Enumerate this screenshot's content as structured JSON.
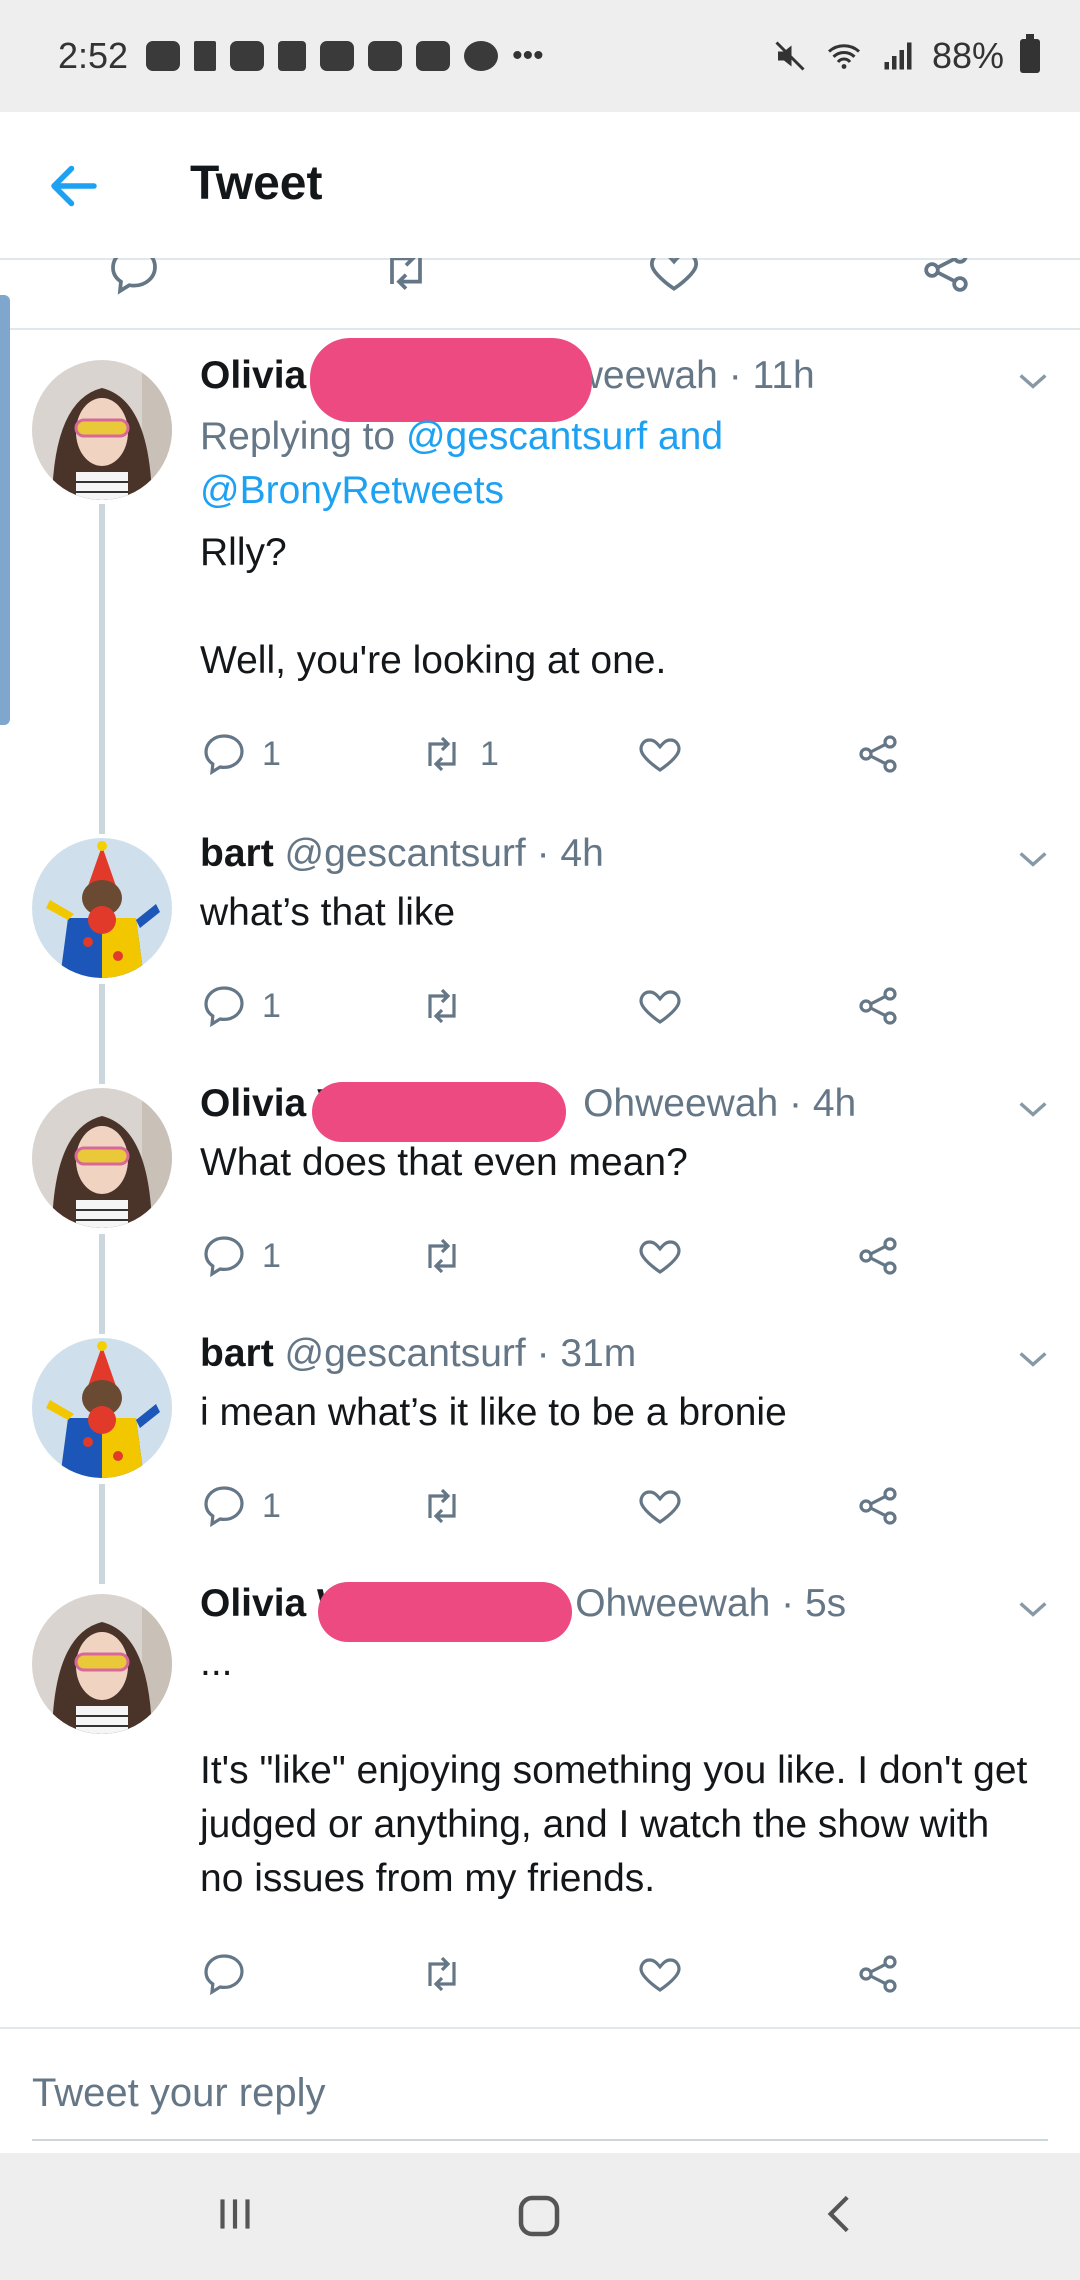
{
  "status_bar": {
    "time": "2:52",
    "battery": "88%"
  },
  "app_bar": {
    "title": "Tweet"
  },
  "tweets": [
    {
      "name": "Olivia V",
      "handle_tail": "hweewah",
      "time": "· 11h",
      "reply_prefix": "Replying to ",
      "reply_to": "@gescantsurf and @BronyRetweets",
      "text": "Rlly?\n\nWell, you're looking at one.",
      "replies": "1",
      "retweets": "1",
      "likes": ""
    },
    {
      "name": "bart",
      "handle": "@gescantsurf",
      "time": "· 4h",
      "text": "what’s that like",
      "replies": "1",
      "retweets": "",
      "likes": ""
    },
    {
      "name": "Olivia V",
      "handle_tail": "Ohweewah",
      "time": "· 4h",
      "text": "What does that even mean?",
      "replies": "1",
      "retweets": "",
      "likes": ""
    },
    {
      "name": "bart",
      "handle": "@gescantsurf",
      "time": "· 31m",
      "text": "i mean what’s it like to be a bronie",
      "replies": "1",
      "retweets": "",
      "likes": ""
    },
    {
      "name": "Olivia Wil",
      "handle_tail": "Ohweewah",
      "time": "· 5s",
      "text": "...\n\nIt's \"like\" enjoying something you like. I don't get judged or anything, and I watch the show with no issues from my friends.",
      "replies": "",
      "retweets": "",
      "likes": ""
    }
  ],
  "composer": {
    "placeholder": "Tweet your reply"
  },
  "colors": {
    "accent": "#1da1f2",
    "muted": "#657786",
    "redaction": "#ec4a80"
  }
}
